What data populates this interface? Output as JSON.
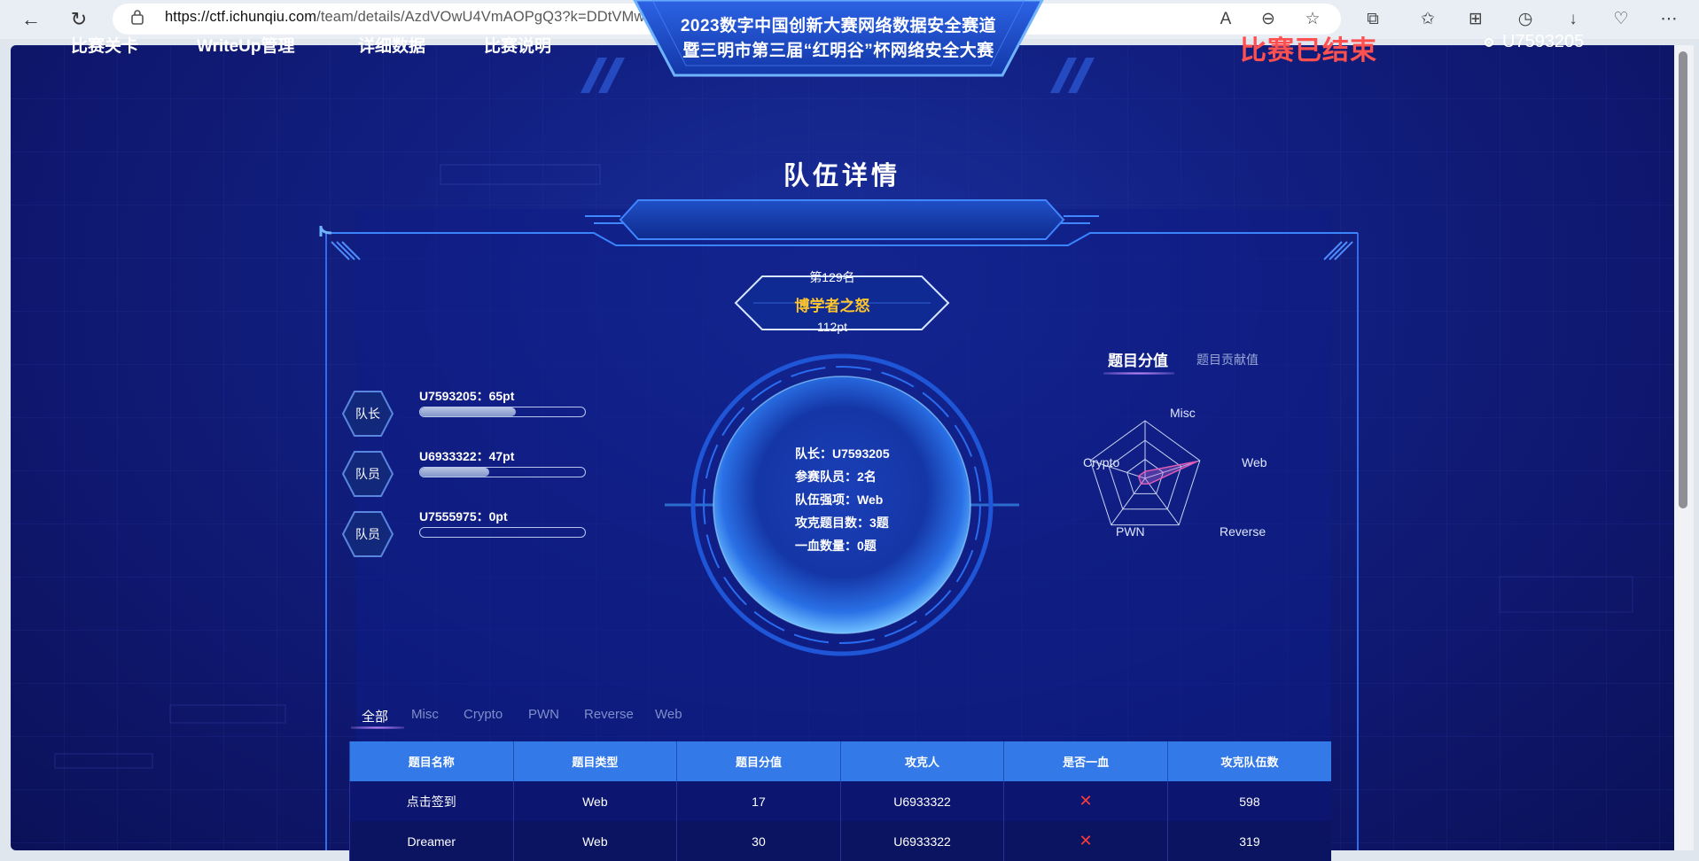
{
  "browser": {
    "url_host": "https://ctf.ichunqiu.com",
    "url_path": "/team/details/AzdVOwU4VmAOPgQ3?k=DDtVMwA7UmQOYgptDGZWZgdgVjIIM1A3AGwIYV5nUmEBMlQ6",
    "icons": [
      "back-arrow-icon",
      "refresh-icon",
      "lock-icon",
      "read-aloud-icon",
      "zoom-out-icon",
      "favorite-star-icon",
      "extensions-icon",
      "favorites-icon",
      "collections-icon",
      "history-icon",
      "downloads-icon",
      "browser-essentials-icon",
      "more-menu-icon"
    ]
  },
  "nav": {
    "items": [
      "比赛关卡",
      "WriteUp管理",
      "详细数据",
      "比赛说明"
    ],
    "banner_line1": "2023数字中国创新大赛网络数据安全赛道",
    "banner_line2": "暨三明市第三届“红明谷”杯网络安全大赛",
    "status": "比赛已结束",
    "username": "U7593205"
  },
  "panel": {
    "title": "队伍详情",
    "rank": "第129名",
    "team_name": "博学者之怒",
    "team_points": "112pt"
  },
  "members": [
    {
      "role": "队长",
      "label": "U7593205：65pt",
      "progress": 0.58
    },
    {
      "role": "队员",
      "label": "U6933322：47pt",
      "progress": 0.42
    },
    {
      "role": "队员",
      "label": "U7555975：0pt",
      "progress": 0
    }
  ],
  "stats": [
    "队长：U7593205",
    "参赛队员：2名",
    "队伍强项：Web",
    "攻克题目数：3题",
    "一血数量：0题"
  ],
  "radar": {
    "tabs": [
      "题目分值",
      "题目贡献值"
    ],
    "axes": [
      "Misc",
      "Web",
      "Reverse",
      "PWN",
      "Crypto"
    ],
    "values": [
      0.12,
      0.95,
      0.12,
      0.12,
      0.12
    ]
  },
  "filters": [
    "全部",
    "Misc",
    "Crypto",
    "PWN",
    "Reverse",
    "Web"
  ],
  "table": {
    "headers": [
      "题目名称",
      "题目类型",
      "题目分值",
      "攻克人",
      "是否一血",
      "攻克队伍数"
    ],
    "rows": [
      {
        "name": "点击签到",
        "type": "Web",
        "score": "17",
        "solver": "U6933322",
        "first_blood": "✕",
        "teams": "598"
      },
      {
        "name": "Dreamer",
        "type": "Web",
        "score": "30",
        "solver": "U6933322",
        "first_blood": "✕",
        "teams": "319"
      }
    ]
  },
  "colors": {
    "accent_blue": "#3379e8",
    "status_red": "#ff5050",
    "team_gold": "#ffc52a"
  }
}
